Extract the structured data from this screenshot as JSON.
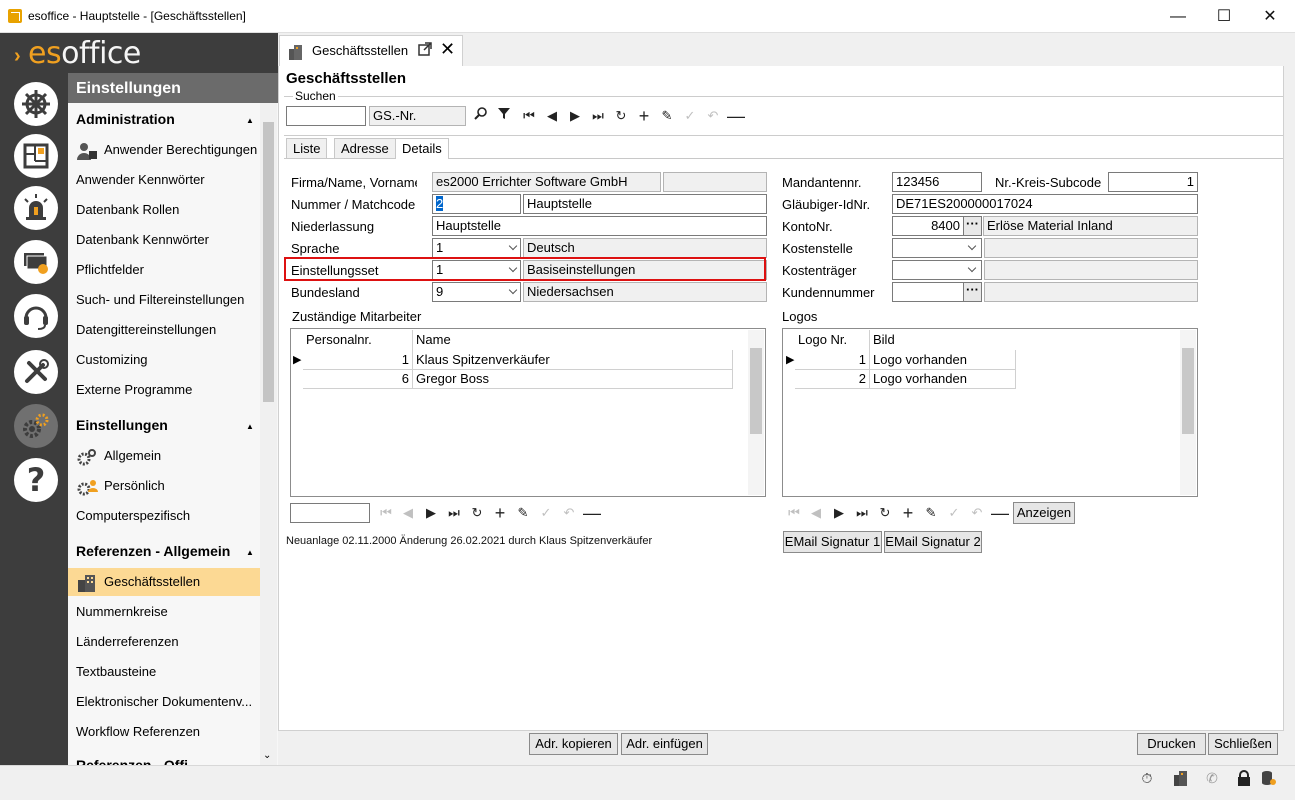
{
  "window": {
    "title": "esoffice - Hauptstelle - [Geschäftsstellen]",
    "minimize": "—",
    "maximize": "☐",
    "close": "✕"
  },
  "logo": {
    "mark": "›",
    "text_a": "es",
    "text_b": "office"
  },
  "sidebar": {
    "header": "Einstellungen",
    "sections": [
      {
        "title": "Administration",
        "items": [
          "Anwender Berechtigungen",
          "Anwender Kennwörter",
          "Datenbank Rollen",
          "Datenbank Kennwörter",
          "Pflichtfelder",
          "Such- und Filtereinstellungen",
          "Datengittereinstellungen",
          "Customizing",
          "Externe Programme"
        ]
      },
      {
        "title": "Einstellungen",
        "items": [
          "Allgemein",
          "Persönlich",
          "Computerspezifisch"
        ]
      },
      {
        "title": "Referenzen - Allgemein",
        "items": [
          "Geschäftsstellen",
          "Nummernkreise",
          "Länderreferenzen",
          "Textbausteine",
          "Elektronischer Dokumentenv...",
          "Workflow Referenzen"
        ]
      },
      {
        "title": "Referenzen - Offi"
      }
    ]
  },
  "doc_tab": {
    "label": "Geschäftsstellen"
  },
  "page": {
    "title": "Geschäftsstellen"
  },
  "search": {
    "legend": "Suchen",
    "value": "",
    "field": "GS.-Nr."
  },
  "subtabs": [
    "Liste",
    "Adresse",
    "Details"
  ],
  "form_left": {
    "firma_label": "Firma/Name, Vorname",
    "firma_value": "es2000 Errichter Software GmbH",
    "firma_value2": "",
    "nummer_label": "Nummer / Matchcode",
    "nummer_value": "2",
    "matchcode_value": "Hauptstelle",
    "niederlassung_label": "Niederlassung",
    "niederlassung_value": "Hauptstelle",
    "sprache_label": "Sprache",
    "sprache_value": "1",
    "sprache_text": "Deutsch",
    "einstellungsset_label": "Einstellungsset",
    "einstellungsset_value": "1",
    "einstellungsset_text": "Basiseinstellungen",
    "bundesland_label": "Bundesland",
    "bundesland_value": "9",
    "bundesland_text": "Niedersachsen"
  },
  "form_right": {
    "mandant_label": "Mandantennr.",
    "mandant_value": "123456",
    "subcode_label": "Nr.-Kreis-Subcode",
    "subcode_value": "1",
    "glaeubiger_label": "Gläubiger-IdNr.",
    "glaeubiger_value": "DE71ES200000017024",
    "konto_label": "KontoNr.",
    "konto_value": "8400",
    "konto_text": "Erlöse Material Inland",
    "kostenstelle_label": "Kostenstelle",
    "kostentraeger_label": "Kostenträger",
    "kundennummer_label": "Kundennummer"
  },
  "mitarbeiter": {
    "title": "Zuständige Mitarbeiter",
    "columns": [
      "Personalnr.",
      "Name"
    ],
    "rows": [
      {
        "nr": "1",
        "name": "Klaus Spitzenverkäufer"
      },
      {
        "nr": "6",
        "name": "Gregor Boss"
      }
    ]
  },
  "logos": {
    "title": "Logos",
    "columns": [
      "Logo Nr.",
      "Bild"
    ],
    "rows": [
      {
        "nr": "1",
        "bild": "Logo vorhanden"
      },
      {
        "nr": "2",
        "bild": "Logo vorhanden"
      }
    ],
    "anzeigen_label": "Anzeigen",
    "email1_label": "EMail Signatur 1",
    "email2_label": "EMail Signatur 2"
  },
  "status": {
    "text": "Neuanlage 02.11.2000   Änderung   26.02.2021  durch  Klaus Spitzenverkäufer"
  },
  "buttons": {
    "adr_kopieren": "Adr. kopieren",
    "adr_einfuegen": "Adr. einfügen",
    "drucken": "Drucken",
    "schliessen": "Schließen"
  },
  "colors": {
    "dark_bar": "#3d3d3d",
    "brand_orange": "#f0a020",
    "active_menu": "#fcd994",
    "highlight_border": "#dd1111"
  }
}
